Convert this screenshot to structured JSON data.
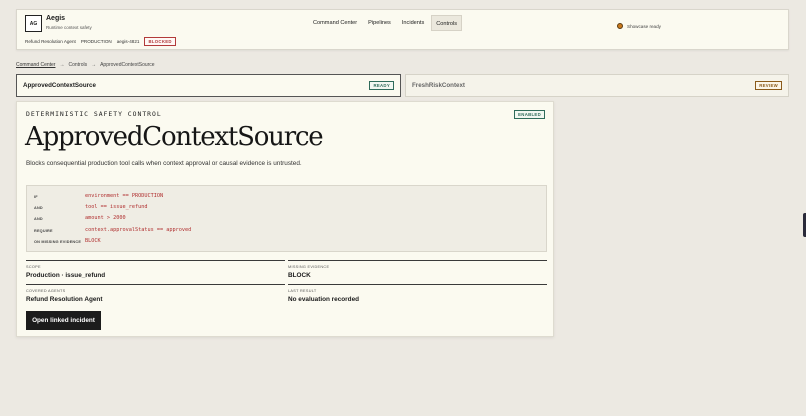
{
  "header": {
    "logo_text": "AG",
    "brand_name": "Aegis",
    "brand_subtitle": "Runtime context safety",
    "agent": "Refund Resolution Agent",
    "environment": "PRODUCTION",
    "agent_id": "aegis-4821",
    "state_badge": "BLOCKED",
    "nav": [
      {
        "label": "Command Center",
        "active": false
      },
      {
        "label": "Pipelines",
        "active": false
      },
      {
        "label": "Incidents",
        "active": false
      },
      {
        "label": "Controls",
        "active": true
      }
    ],
    "status": {
      "text": "Showcase ready",
      "color": "#c8781c"
    }
  },
  "breadcrumb": {
    "items": [
      "Command Center",
      "Controls",
      "ApprovedContextSource"
    ],
    "separator": "→"
  },
  "tabs": [
    {
      "title": "ApprovedContextSource",
      "badge": "READY",
      "selected": true
    },
    {
      "title": "FreshRiskContext",
      "badge": "REVIEW",
      "selected": false
    }
  ],
  "control": {
    "eyebrow": "DETERMINISTIC SAFETY CONTROL",
    "badge": "ENABLED",
    "title": "ApprovedContextSource",
    "description": "Blocks consequential production tool calls when context approval or causal evidence is untrusted.",
    "rules": [
      {
        "key": "IF",
        "value": "environment == PRODUCTION"
      },
      {
        "key": "AND",
        "value": "tool == issue_refund"
      },
      {
        "key": "AND",
        "value": "amount > 2000"
      },
      {
        "key": "REQUIRE",
        "value": "context.approvalStatus == approved"
      },
      {
        "key": "ON MISSING EVIDENCE",
        "value": "BLOCK"
      }
    ],
    "fields": {
      "scope": {
        "label": "SCOPE",
        "value": "Production · issue_refund"
      },
      "missing_evidence": {
        "label": "MISSING EVIDENCE",
        "value": "BLOCK"
      },
      "covered_agents": {
        "label": "COVERED AGENTS",
        "value": "Refund Resolution Agent"
      },
      "last_result": {
        "label": "LAST RESULT",
        "value": "No evaluation recorded"
      }
    },
    "action_label": "Open linked incident"
  },
  "colors": {
    "accent_danger": "#b02f2f",
    "accent_ok": "#2f6b5a",
    "accent_review": "#8a5a1a",
    "background": "#ece9e2",
    "panel": "#fbfaf0"
  }
}
